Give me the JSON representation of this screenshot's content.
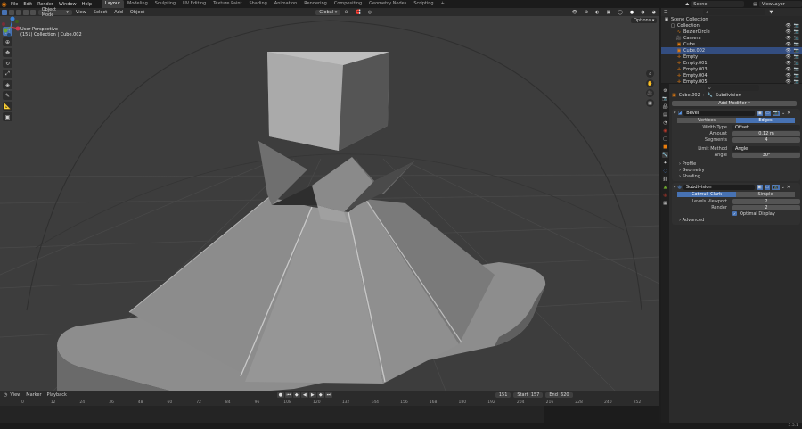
{
  "topbar": {
    "menus": [
      "File",
      "Edit",
      "Render",
      "Window",
      "Help"
    ],
    "workspaces": [
      "Layout",
      "Modeling",
      "Sculpting",
      "UV Editing",
      "Texture Paint",
      "Shading",
      "Animation",
      "Rendering",
      "Compositing",
      "Geometry Nodes",
      "Scripting"
    ],
    "active_workspace": "Layout",
    "scene": "Scene",
    "view_layer": "ViewLayer"
  },
  "viewport": {
    "mode": "Object Mode",
    "menus": [
      "View",
      "Select",
      "Add",
      "Object"
    ],
    "orientation": "Global",
    "perspective_label": "User Perspective",
    "context_label": "(151) Collection | Cube.002",
    "options_label": "Options"
  },
  "timeline": {
    "menus": [
      "View",
      "Marker",
      "Playback"
    ],
    "current_frame": "151",
    "start_label": "Start",
    "start": "157",
    "end_label": "End",
    "end": "620",
    "ticks": [
      "0",
      "12",
      "24",
      "36",
      "48",
      "60",
      "72",
      "84",
      "96",
      "108",
      "120",
      "132",
      "144",
      "156",
      "168",
      "180",
      "192",
      "204",
      "216",
      "228",
      "240",
      "252"
    ]
  },
  "outliner": {
    "search_placeholder": "",
    "items": [
      {
        "label": "Scene Collection",
        "icon": "scene-collection-icon",
        "indent": 0,
        "selected": false
      },
      {
        "label": "Collection",
        "icon": "collection-icon",
        "indent": 1,
        "selected": false
      },
      {
        "label": "BezierCircle",
        "icon": "curve-icon",
        "indent": 2,
        "selected": false
      },
      {
        "label": "Camera",
        "icon": "camera-icon",
        "indent": 2,
        "selected": false
      },
      {
        "label": "Cube",
        "icon": "mesh-icon",
        "indent": 2,
        "selected": false
      },
      {
        "label": "Cube.002",
        "icon": "mesh-icon",
        "indent": 2,
        "selected": true
      },
      {
        "label": "Empty",
        "icon": "empty-icon",
        "indent": 2,
        "selected": false
      },
      {
        "label": "Empty.001",
        "icon": "empty-icon",
        "indent": 2,
        "selected": false
      },
      {
        "label": "Empty.003",
        "icon": "empty-icon",
        "indent": 2,
        "selected": false
      },
      {
        "label": "Empty.004",
        "icon": "empty-icon",
        "indent": 2,
        "selected": false
      },
      {
        "label": "Empty.005",
        "icon": "empty-icon",
        "indent": 2,
        "selected": false
      }
    ]
  },
  "properties": {
    "breadcrumb_object": "Cube.002",
    "breadcrumb_sep": "›",
    "breadcrumb_modifier": "Subdivision",
    "add_modifier": "Add Modifier",
    "bevel": {
      "name": "Bevel",
      "affect_options": [
        "Vertices",
        "Edges"
      ],
      "affect_active": "Edges",
      "width_type_label": "Width Type",
      "width_type": "Offset",
      "amount_label": "Amount",
      "amount": "0.12 m",
      "segments_label": "Segments",
      "segments": "4",
      "limit_method_label": "Limit Method",
      "limit_method": "Angle",
      "angle_label": "Angle",
      "angle": "30°",
      "subpanels": [
        "Profile",
        "Geometry",
        "Shading"
      ]
    },
    "subsurf": {
      "name": "Subdivision",
      "type_options": [
        "Catmull-Clark",
        "Simple"
      ],
      "type_active": "Catmull-Clark",
      "levels_viewport_label": "Levels Viewport",
      "levels_viewport": "2",
      "render_label": "Render",
      "render": "2",
      "optimal_display_label": "Optimal Display",
      "subpanels": [
        "Advanced"
      ]
    }
  },
  "statusbar": {
    "version": "3.3.1"
  },
  "colors": {
    "accent_blue": "#4772b3",
    "selection_row": "#334d80",
    "orange_object": "#e87d0d"
  }
}
